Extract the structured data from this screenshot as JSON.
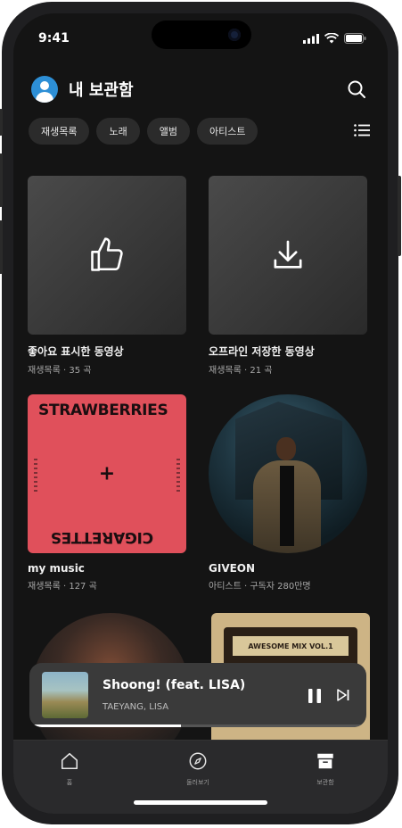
{
  "status_bar": {
    "time": "9:41"
  },
  "header": {
    "title": "내 보관함"
  },
  "chips": [
    "재생목록",
    "노래",
    "앨범",
    "아티스트"
  ],
  "cards": [
    {
      "title": "좋아요 표시한 동영상",
      "subtitle": "재생목록 · 35 곡",
      "icon": "thumbs-up-icon"
    },
    {
      "title": "오프라인 저장한 동영상",
      "subtitle": "재생목록 · 21 곡",
      "icon": "download-icon"
    },
    {
      "title": "my music",
      "subtitle": "재생목록 · 127 곡",
      "cover_top": "STRAWBERRIES",
      "cover_bottom": "CIGARETTES",
      "cover_center": "+"
    },
    {
      "title": "GIVEON",
      "subtitle": "아티스트 · 구독자 280만명"
    }
  ],
  "row3": {
    "tape_label": "AWESOME MIX VOL.1"
  },
  "now_playing": {
    "title": "Shoong! (feat. LISA)",
    "artist": "TAEYANG, LISA",
    "progress": 0.45
  },
  "tabs": [
    {
      "label": "홈",
      "icon": "home-icon"
    },
    {
      "label": "둘러보기",
      "icon": "compass-icon"
    },
    {
      "label": "보관함",
      "icon": "library-icon"
    }
  ],
  "colors": {
    "accent_avatar": "#2d8fd6",
    "cover_red": "#e0505b",
    "background": "#141414"
  }
}
